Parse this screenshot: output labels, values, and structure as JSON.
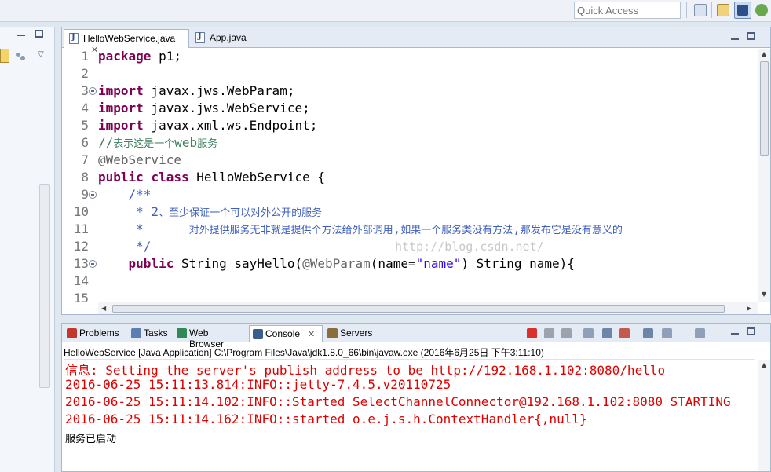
{
  "toolbar": {
    "quick_access_placeholder": "Quick Access"
  },
  "editor": {
    "tabs": [
      {
        "label": "HelloWebService.java",
        "active": true
      },
      {
        "label": "App.java",
        "active": false
      }
    ],
    "close_glyph": "✕",
    "lines": [
      {
        "num": "1",
        "fold": false,
        "segments": [
          {
            "t": "package",
            "c": "kw"
          },
          {
            "t": " p1;",
            "c": ""
          }
        ]
      },
      {
        "num": "2",
        "fold": false,
        "segments": []
      },
      {
        "num": "3",
        "fold": true,
        "segments": [
          {
            "t": "import",
            "c": "kw"
          },
          {
            "t": " javax.jws.WebParam;",
            "c": ""
          }
        ]
      },
      {
        "num": "4",
        "fold": false,
        "segments": [
          {
            "t": "import",
            "c": "kw"
          },
          {
            "t": " javax.jws.WebService;",
            "c": ""
          }
        ]
      },
      {
        "num": "5",
        "fold": false,
        "segments": [
          {
            "t": "import",
            "c": "kw"
          },
          {
            "t": " javax.xml.ws.Endpoint;",
            "c": ""
          }
        ]
      },
      {
        "num": "6",
        "fold": false,
        "segments": [
          {
            "t": "//",
            "c": "cm"
          },
          {
            "t": "表示这是一个",
            "c": "cm cn"
          },
          {
            "t": "web",
            "c": "cm"
          },
          {
            "t": "服务",
            "c": "cm cn"
          }
        ]
      },
      {
        "num": "7",
        "fold": false,
        "segments": [
          {
            "t": "@WebService",
            "c": "an"
          }
        ]
      },
      {
        "num": "8",
        "fold": false,
        "segments": [
          {
            "t": "public",
            "c": "kw"
          },
          {
            "t": " ",
            "c": ""
          },
          {
            "t": "class",
            "c": "kw"
          },
          {
            "t": " HelloWebService {",
            "c": ""
          }
        ]
      },
      {
        "num": "9",
        "fold": true,
        "segments": [
          {
            "t": "    /**",
            "c": "jd"
          }
        ]
      },
      {
        "num": "10",
        "fold": false,
        "segments": [
          {
            "t": "     * 2",
            "c": "jd"
          },
          {
            "t": "、至少保证一个可以对外公开的服务",
            "c": "jd cn"
          }
        ]
      },
      {
        "num": "11",
        "fold": false,
        "segments": [
          {
            "t": "     *      ",
            "c": "jd"
          },
          {
            "t": "对外提供服务无非就是提供个方法给外部调用",
            "c": "jd cn"
          },
          {
            "t": ",",
            "c": "jd"
          },
          {
            "t": "如果一个服务类没有方法",
            "c": "jd cn"
          },
          {
            "t": ",",
            "c": "jd"
          },
          {
            "t": "那发布它是没有意义的",
            "c": "jd cn"
          }
        ]
      },
      {
        "num": "12",
        "fold": false,
        "segments": [
          {
            "t": "     */",
            "c": "jd"
          }
        ]
      },
      {
        "num": "13",
        "fold": true,
        "segments": [
          {
            "t": "    ",
            "c": ""
          },
          {
            "t": "public",
            "c": "kw"
          },
          {
            "t": " String sayHello(",
            "c": ""
          },
          {
            "t": "@WebParam",
            "c": "an"
          },
          {
            "t": "(name=",
            "c": ""
          },
          {
            "t": "\"name\"",
            "c": "st"
          },
          {
            "t": ") String name){",
            "c": ""
          }
        ]
      },
      {
        "num": "14",
        "fold": false,
        "segments": []
      },
      {
        "num": "15",
        "fold": false,
        "segments": []
      }
    ],
    "watermark": "http://blog.csdn.net/"
  },
  "console": {
    "tabs": [
      {
        "label": "Problems",
        "icon": "problems-icon",
        "color": "#c0392b"
      },
      {
        "label": "Tasks",
        "icon": "tasks-icon",
        "color": "#5a7fb0"
      },
      {
        "label": "Web Browser",
        "icon": "globe-icon",
        "color": "#2e8b57"
      },
      {
        "label": "Console",
        "icon": "console-icon",
        "color": "#3b5e91",
        "active": true
      },
      {
        "label": "Servers",
        "icon": "servers-icon",
        "color": "#8a6d3b"
      }
    ],
    "description": "HelloWebService [Java Application] C:\\Program Files\\Java\\jdk1.8.0_66\\bin\\javaw.exe (2016年6月25日 下午3:11:10)",
    "output": [
      {
        "text": "信息: Setting the server's publish address to be http://192.168.1.102:8080/hello",
        "style": "red"
      },
      {
        "text": "2016-06-25 15:11:13.814:INFO::jetty-7.4.5.v20110725",
        "style": "red"
      },
      {
        "text": "2016-06-25 15:11:14.102:INFO::Started SelectChannelConnector@192.168.1.102:8080 STARTING",
        "style": "red"
      },
      {
        "text": "2016-06-25 15:11:14.162:INFO::started o.e.j.s.h.ContextHandler{,null}",
        "style": "red"
      },
      {
        "text": "服务已启动",
        "style": "black"
      }
    ],
    "toolbar_icons": [
      "terminate-icon",
      "remove-launch-icon",
      "remove-all-icon",
      "clear-console-icon",
      "scroll-lock-icon",
      "word-wrap-icon",
      "pin-console-icon",
      "display-console-icon",
      "open-console-icon"
    ]
  },
  "colors": {
    "keyword": "#7f0055",
    "comment": "#3f7f5f",
    "javadoc": "#3f5fbf",
    "annotation": "#646464",
    "string": "#2a00ff",
    "console_error": "#e00000"
  }
}
